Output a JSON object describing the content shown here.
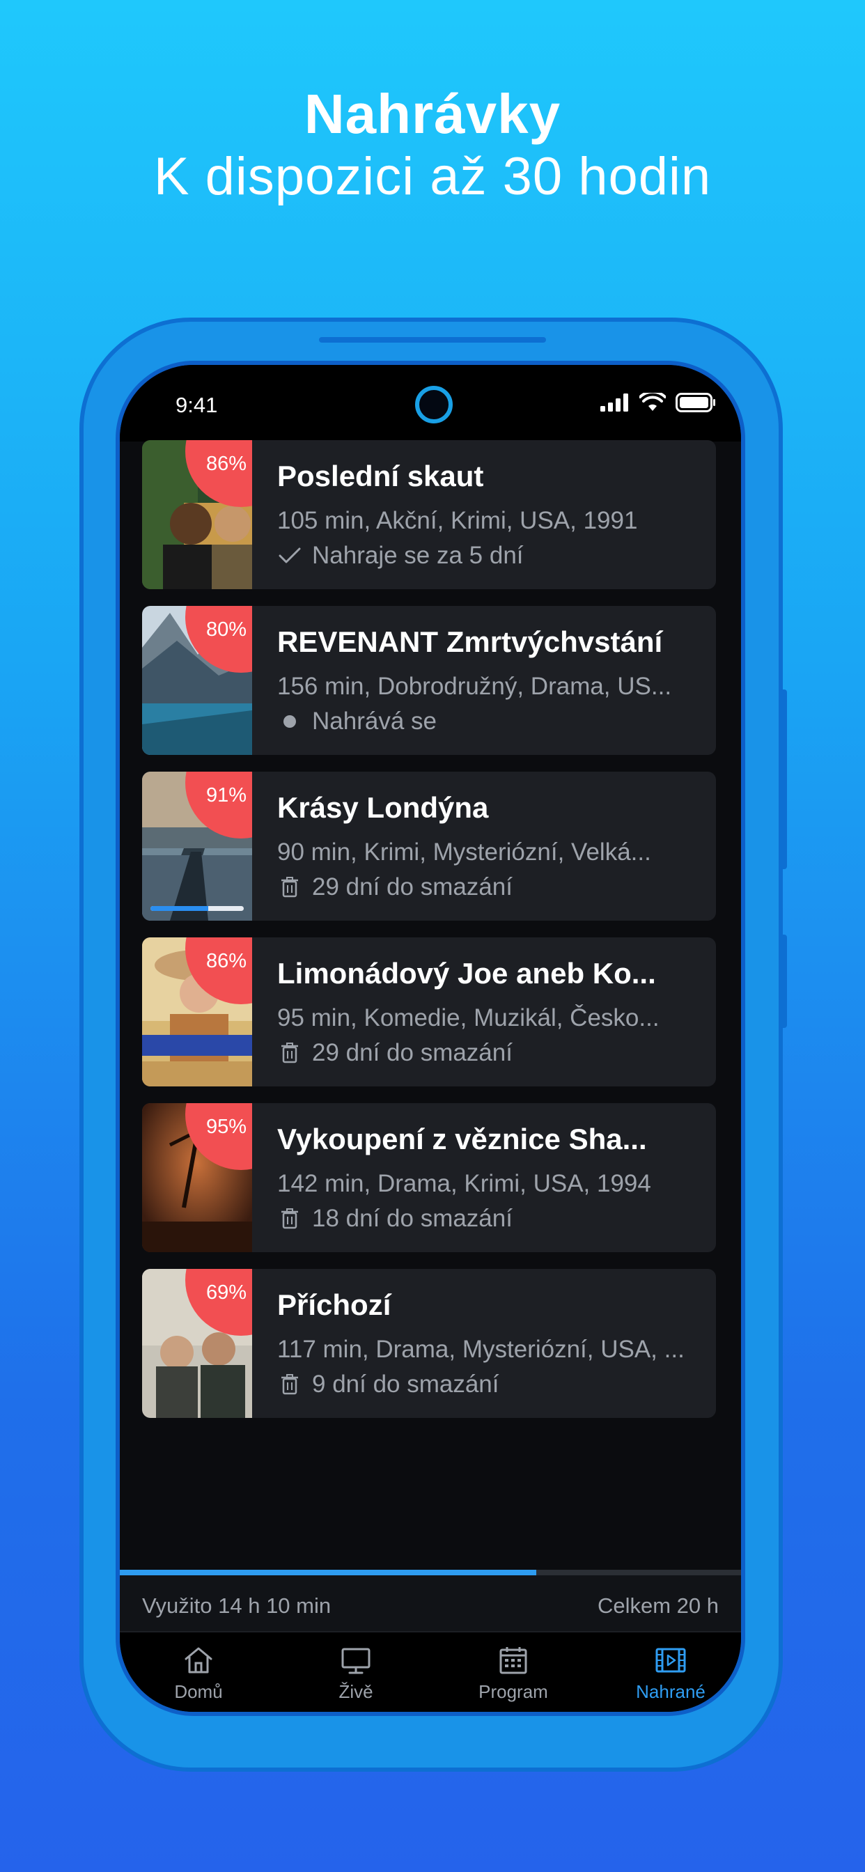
{
  "promo": {
    "title": "Nahrávky",
    "subtitle": "K dispozici až 30 hodin"
  },
  "status_bar": {
    "time": "9:41"
  },
  "recordings": [
    {
      "title": "Poslední skaut",
      "meta": "105 min, Akční, Krimi, USA, 1991",
      "percent_label": "86%",
      "status_icon": "check-icon",
      "status_text": "Nahraje se za 5 dní"
    },
    {
      "title": "REVENANT Zmrtvýchvstání",
      "meta": "156 min, Dobrodružný, Drama, US...",
      "percent_label": "80%",
      "status_icon": "dot-icon",
      "status_text": "Nahrává se"
    },
    {
      "title": "Krásy Londýna",
      "meta": "90 min, Krimi, Mysteriózní, Velká...",
      "percent_label": "91%",
      "status_icon": "trash-icon",
      "status_text": "29 dní do smazání",
      "watch_progress": 0.62
    },
    {
      "title": "Limonádový Joe aneb Ko...",
      "meta": "95 min, Komedie, Muzikál, Česko...",
      "percent_label": "86%",
      "status_icon": "trash-icon",
      "status_text": "29 dní do smazání"
    },
    {
      "title": "Vykoupení z věznice Sha...",
      "meta": "142 min, Drama, Krimi, USA, 1994",
      "percent_label": "95%",
      "status_icon": "trash-icon",
      "status_text": "18 dní do smazání"
    },
    {
      "title": "Příchozí",
      "meta": "117 min, Drama, Mysteriózní, USA, ...",
      "percent_label": "69%",
      "status_icon": "trash-icon",
      "status_text": "9 dní do smazání"
    }
  ],
  "storage": {
    "used_text": "Využito 14 h 10 min",
    "total_text": "Celkem 20 h",
    "used_fraction": 0.67
  },
  "tabs": [
    {
      "label": "Domů",
      "icon": "home-icon",
      "active": false
    },
    {
      "label": "Živě",
      "icon": "monitor-icon",
      "active": false
    },
    {
      "label": "Program",
      "icon": "calendar-icon",
      "active": false
    },
    {
      "label": "Nahrané",
      "icon": "film-icon",
      "active": true
    }
  ],
  "colors": {
    "badge": "#f24f52",
    "accent": "#2f9df2",
    "card_bg": "#1d1f24"
  }
}
